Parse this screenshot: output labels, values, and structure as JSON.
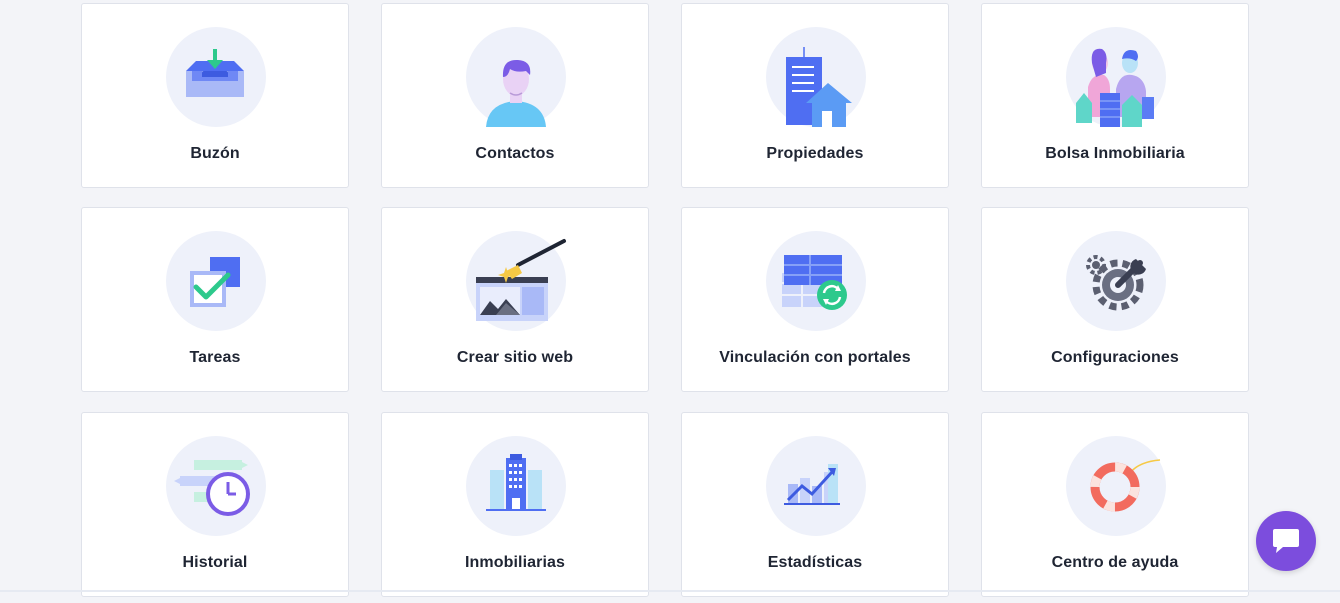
{
  "cards": [
    {
      "label": "Buzón",
      "icon": "inbox-icon"
    },
    {
      "label": "Contactos",
      "icon": "contact-person-icon"
    },
    {
      "label": "Propiedades",
      "icon": "properties-building-icon"
    },
    {
      "label": "Bolsa Inmobiliaria",
      "icon": "real-estate-pool-icon"
    },
    {
      "label": "Tareas",
      "icon": "tasks-checkbox-icon"
    },
    {
      "label": "Crear sitio web",
      "icon": "website-builder-icon"
    },
    {
      "label": "Vinculación con portales",
      "icon": "portals-sync-icon"
    },
    {
      "label": "Configuraciones",
      "icon": "settings-gear-icon"
    },
    {
      "label": "Historial",
      "icon": "history-clock-icon"
    },
    {
      "label": "Inmobiliarias",
      "icon": "agencies-building-icon"
    },
    {
      "label": "Estadísticas",
      "icon": "statistics-chart-icon"
    },
    {
      "label": "Centro de ayuda",
      "icon": "help-lifebuoy-icon"
    }
  ],
  "chat": {
    "icon": "chat-bubble-icon"
  },
  "colors": {
    "background": "#f3f4f8",
    "card": "#ffffff",
    "icon_bg": "#eef1fa",
    "accent": "#7c4ddd",
    "primary": "#4f6ef2"
  }
}
